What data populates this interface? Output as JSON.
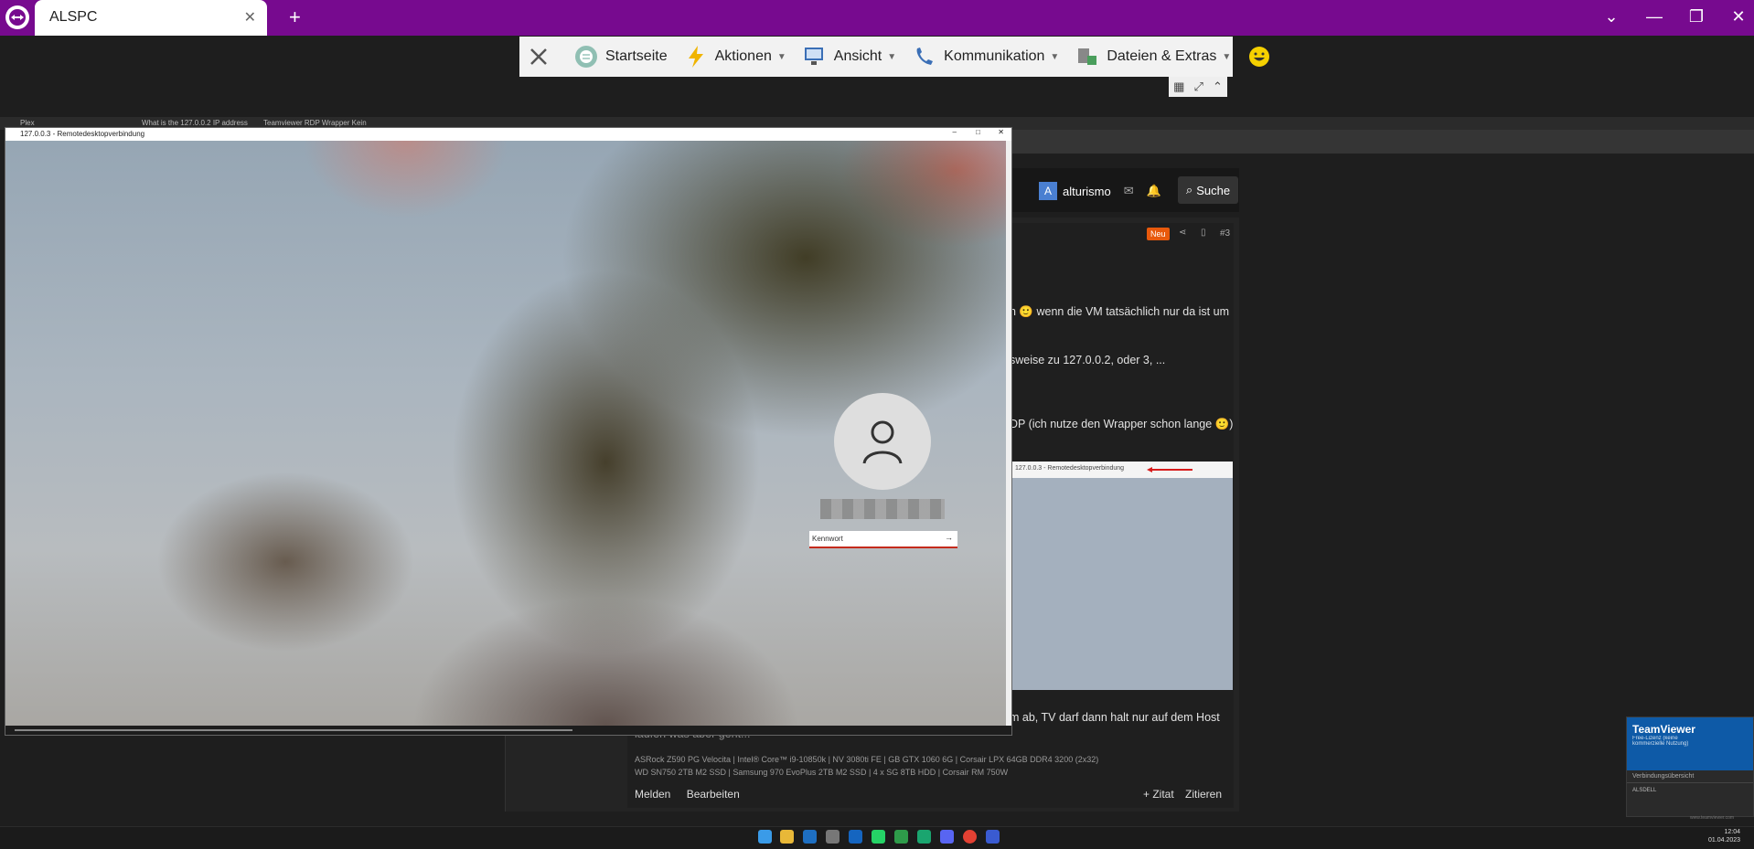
{
  "teamviewer": {
    "tab_title": "ALSPC",
    "toolbar": {
      "items": [
        {
          "label": "Startseite"
        },
        {
          "label": "Aktionen"
        },
        {
          "label": "Ansicht"
        },
        {
          "label": "Kommunikation"
        },
        {
          "label": "Dateien & Extras"
        }
      ]
    }
  },
  "remote_browser": {
    "tabs": [
      "Plex",
      "What is the 127.0.0.2 IP address",
      "Teamviewer RDP Wrapper Kein"
    ],
    "forum": {
      "username": "alturismo",
      "avatar_letter": "A",
      "search_label": "Suche",
      "badge_new": "Neu",
      "post_number": "#3",
      "text_lines": [
        "n 🙂 wenn die VM tatsächlich nur da ist um",
        "sweise zu 127.0.0.2, oder 3, ...",
        "DP (ich nutze den Wrapper schon lange 🙂)",
        "m ab, TV darf dann halt nur auf dem Host",
        "laufen was aber geht..."
      ],
      "screenshot_caption": "127.0.0.3 - Remotedesktopverbindung",
      "signature": [
        "ASRock Z590 PG Velocita | Intel® Core™ i9-10850k | NV 3080ti FE | GB GTX 1060 6G | Corsair LPX 64GB DDR4 3200 (2x32)",
        "WD SN750 2TB M2 SSD | Samsung 970 EvoPlus 2TB M2 SSD | 4 x SG 8TB HDD | Corsair RM 750W"
      ],
      "actions": {
        "report": "Melden",
        "edit": "Bearbeiten",
        "quote": "+ Zitat",
        "cite": "Zitieren"
      }
    }
  },
  "rdp_window": {
    "title": "127.0.0.3 - Remotedesktopverbindung",
    "password_placeholder": "Kennwort"
  },
  "tv_panel": {
    "title": "TeamViewer",
    "subtitle": "Free-Lizenz (keine kommerzielle Nutzung)",
    "section": "Verbindungsübersicht",
    "connection": "ALSDELL",
    "footer": "www.teamviewer.com"
  },
  "taskbar": {
    "time": "12:04",
    "date": "01.04.2023"
  },
  "colors": {
    "teamviewer_purple": "#770a8f",
    "accent_red": "#c42b1c",
    "neu_orange": "#e8590c"
  }
}
